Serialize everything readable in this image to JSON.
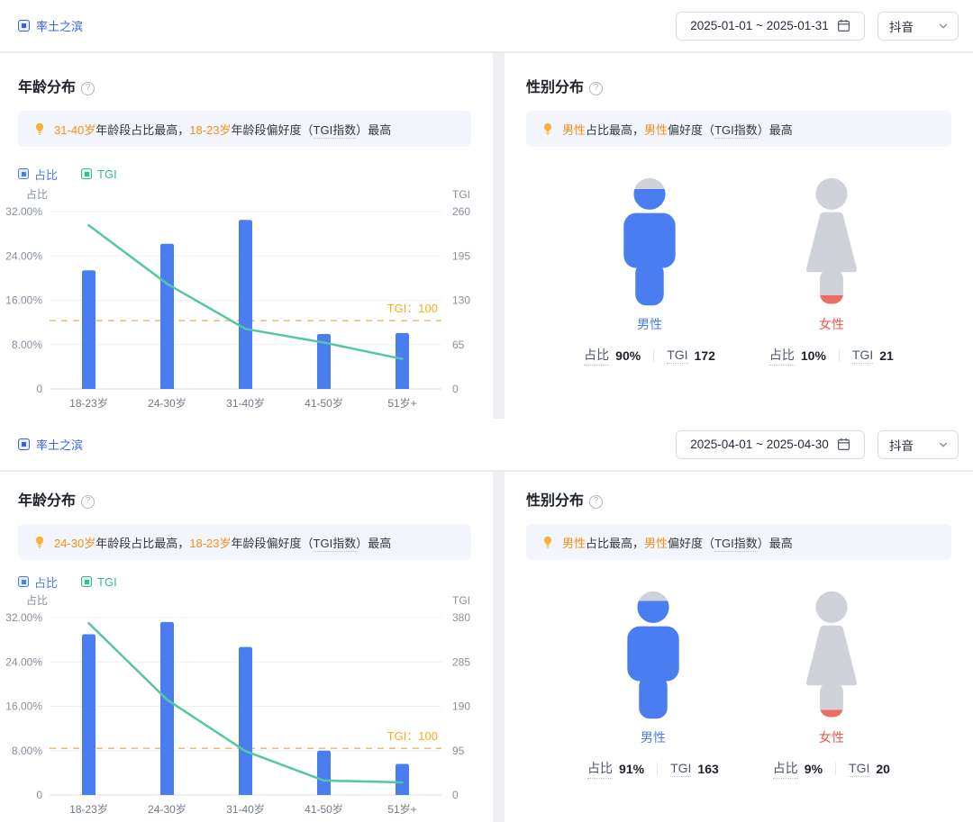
{
  "colors": {
    "bar": "#4a7df0",
    "line": "#55c7a0",
    "baseline": "#e8c27d",
    "baseline_label": "#faad14",
    "figure_empty": "#cfd3d9",
    "male_fill": "#4a7df0",
    "female_fill": "#ec6e62",
    "brand_blue": "#3662ec",
    "insight_orange": "#fa8c16"
  },
  "page": {
    "sections": [
      {
        "header": {
          "brand": "率土之滨",
          "date_range": "2025-01-01 ~ 2025-01-31",
          "platform": "抖音"
        },
        "age": {
          "title": "年龄分布",
          "insight": {
            "hl1": "31-40岁",
            "t1": "年龄段占比最高，",
            "hl2": "18-23岁",
            "t2": "年龄段偏好度（",
            "u": "TGI指数",
            "t3": "）最高"
          }
        },
        "gender": {
          "title": "性别分布",
          "insight": {
            "hl1": "男性",
            "t1": "占比最高，",
            "hl2": "男性",
            "t2": "偏好度（",
            "u": "TGI指数",
            "t3": "）最高"
          },
          "male": {
            "label": "男性",
            "ratio_label": "占比",
            "ratio": "90%",
            "tgi_label": "TGI",
            "tgi": "172",
            "pct": 90
          },
          "female": {
            "label": "女性",
            "ratio_label": "占比",
            "ratio": "10%",
            "tgi_label": "TGI",
            "tgi": "21",
            "pct": 10
          }
        }
      },
      {
        "header": {
          "brand": "率土之滨",
          "date_range": "2025-04-01 ~ 2025-04-30",
          "platform": "抖音"
        },
        "age": {
          "title": "年龄分布",
          "insight": {
            "hl1": "24-30岁",
            "t1": "年龄段占比最高，",
            "hl2": "18-23岁",
            "t2": "年龄段偏好度（",
            "u": "TGI指数",
            "t3": "）最高"
          }
        },
        "gender": {
          "title": "性别分布",
          "insight": {
            "hl1": "男性",
            "t1": "占比最高，",
            "hl2": "男性",
            "t2": "偏好度（",
            "u": "TGI指数",
            "t3": "）最高"
          },
          "male": {
            "label": "男性",
            "ratio_label": "占比",
            "ratio": "91%",
            "tgi_label": "TGI",
            "tgi": "163",
            "pct": 91
          },
          "female": {
            "label": "女性",
            "ratio_label": "占比",
            "ratio": "9%",
            "tgi_label": "TGI",
            "tgi": "20",
            "pct": 9
          }
        }
      }
    ]
  },
  "chart_data": [
    {
      "type": "bar+line",
      "title": "年龄分布 (2025-01-01 ~ 2025-01-31)",
      "categories": [
        "18-23岁",
        "24-30岁",
        "31-40岁",
        "41-50岁",
        "51岁+"
      ],
      "series": [
        {
          "name": "占比",
          "type": "bar",
          "unit": "%",
          "values": [
            21.4,
            26.2,
            30.5,
            9.9,
            10.1
          ]
        },
        {
          "name": "TGI",
          "type": "line",
          "values": [
            240,
            154,
            88,
            68,
            44
          ]
        }
      ],
      "left_axis": {
        "label": "占比",
        "max": 32,
        "ticks": [
          "32.00%",
          "24.00%",
          "16.00%",
          "8.00%",
          "0"
        ]
      },
      "right_axis": {
        "label": "TGI",
        "max": 260,
        "ticks": [
          "260",
          "195",
          "130",
          "65",
          "0"
        ]
      },
      "baseline": {
        "value": 100,
        "label": "TGI：100"
      },
      "grid": true,
      "legend_position": "top-left"
    },
    {
      "type": "bar+line",
      "title": "年龄分布 (2025-04-01 ~ 2025-04-30)",
      "categories": [
        "18-23岁",
        "24-30岁",
        "31-40岁",
        "41-50岁",
        "51岁+"
      ],
      "series": [
        {
          "name": "占比",
          "type": "bar",
          "unit": "%",
          "values": [
            29.0,
            31.2,
            26.7,
            8.0,
            5.6
          ]
        },
        {
          "name": "TGI",
          "type": "line",
          "values": [
            368,
            204,
            94,
            31,
            27
          ]
        }
      ],
      "left_axis": {
        "label": "占比",
        "max": 32,
        "ticks": [
          "32.00%",
          "24.00%",
          "16.00%",
          "8.00%",
          "0"
        ]
      },
      "right_axis": {
        "label": "TGI",
        "max": 380,
        "ticks": [
          "380",
          "285",
          "190",
          "95",
          "0"
        ]
      },
      "baseline": {
        "value": 100,
        "label": "TGI：100"
      },
      "grid": true,
      "legend_position": "top-left"
    }
  ]
}
